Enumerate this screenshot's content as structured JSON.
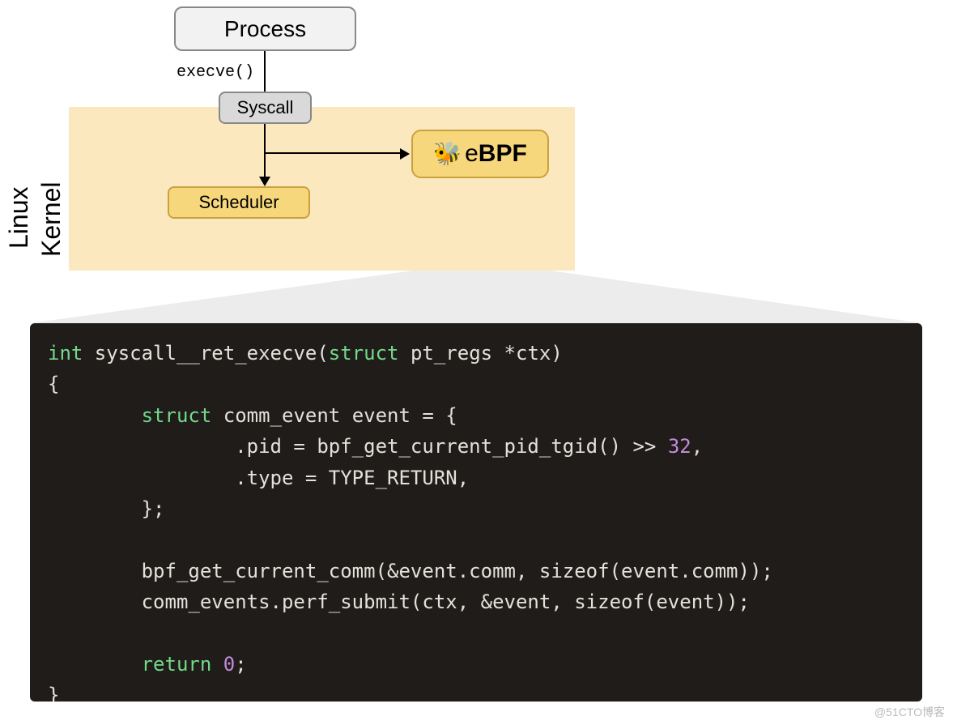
{
  "diagram": {
    "process": "Process",
    "execve": "execve()",
    "syscall": "Syscall",
    "scheduler": "Scheduler",
    "ebpf": "eBPF",
    "kernel_line1": "Linux",
    "kernel_line2": "Kernel"
  },
  "code": {
    "tokens": [
      {
        "cls": "kw",
        "t": "int"
      },
      {
        "cls": "txt",
        "t": " syscall__ret_execve("
      },
      {
        "cls": "kw",
        "t": "struct"
      },
      {
        "cls": "txt",
        "t": " pt_regs *ctx)\n{\n        "
      },
      {
        "cls": "kw",
        "t": "struct"
      },
      {
        "cls": "txt",
        "t": " comm_event event = {\n                .pid = bpf_get_current_pid_tgid() >> "
      },
      {
        "cls": "num",
        "t": "32"
      },
      {
        "cls": "txt",
        "t": ",\n                .type = TYPE_RETURN,\n        };\n\n        bpf_get_current_comm(&event.comm, sizeof(event.comm));\n        comm_events.perf_submit(ctx, &event, sizeof(event));\n\n        "
      },
      {
        "cls": "kw",
        "t": "return"
      },
      {
        "cls": "txt",
        "t": " "
      },
      {
        "cls": "num",
        "t": "0"
      },
      {
        "cls": "txt",
        "t": ";\n}"
      }
    ]
  },
  "watermark": "@51CTO博客"
}
